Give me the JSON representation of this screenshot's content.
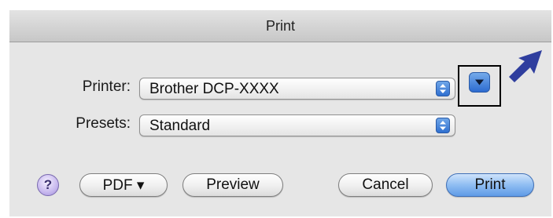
{
  "window": {
    "title": "Print"
  },
  "printer": {
    "label": "Printer:",
    "value": "Brother DCP-XXXX"
  },
  "presets": {
    "label": "Presets:",
    "value": "Standard"
  },
  "buttons": {
    "help": "?",
    "pdf": "PDF ▾",
    "preview": "Preview",
    "cancel": "Cancel",
    "print": "Print"
  },
  "icons": {
    "disclosure": "disclosure-triangle-icon",
    "stepper": "popup-stepper-icon",
    "annotation": "blue-arrow-icon"
  },
  "colors": {
    "accent": "#2f6fd0",
    "annotation_arrow": "#2f3e9e",
    "dialog_bg": "#e6e6e6"
  }
}
